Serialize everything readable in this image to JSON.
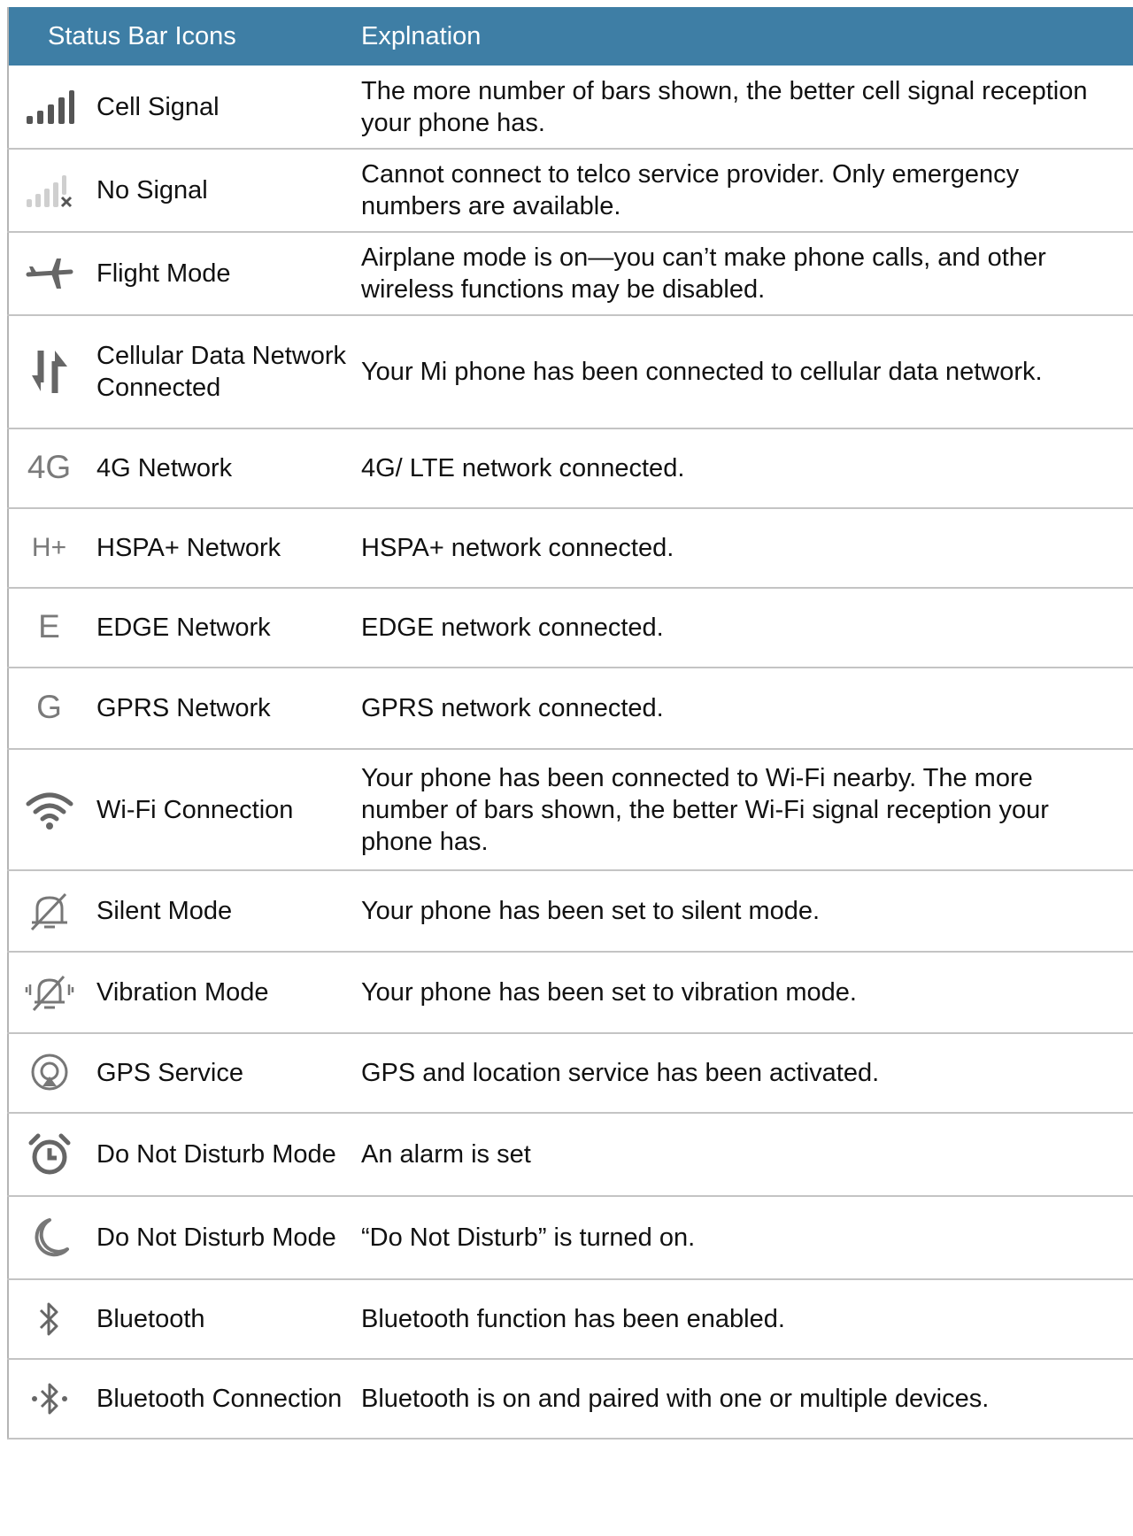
{
  "header": {
    "col_icons": "Status Bar Icons",
    "col_explanation": "Explnation"
  },
  "rows": [
    {
      "icon": "cell-signal-icon",
      "name": "Cell Signal",
      "explanation": "The more number of bars shown, the better cell signal reception your phone has."
    },
    {
      "icon": "no-signal-icon",
      "name": "No Signal",
      "explanation": "Cannot connect to telco service provider. Only emergency numbers are available."
    },
    {
      "icon": "airplane-icon",
      "name": "Flight Mode",
      "explanation": "Airplane mode is on—you can’t make phone calls, and other wireless functions may be disabled."
    },
    {
      "icon": "data-arrows-icon",
      "name": "Cellular Data Network Connected",
      "explanation": "Your Mi phone has been connected to cellular data network."
    },
    {
      "icon": "4g-icon",
      "icon_text": "4G",
      "name": "4G Network",
      "explanation": "4G/ LTE network connected."
    },
    {
      "icon": "hspa-plus-icon",
      "icon_text": "H+",
      "name": "HSPA+ Network",
      "explanation": "HSPA+ network connected."
    },
    {
      "icon": "edge-icon",
      "icon_text": "E",
      "name": "EDGE Network",
      "explanation": "EDGE network connected."
    },
    {
      "icon": "gprs-icon",
      "icon_text": "G",
      "name": "GPRS Network",
      "explanation": "GPRS network connected."
    },
    {
      "icon": "wifi-icon",
      "name": "Wi-Fi Connection",
      "explanation": "Your phone has been connected to Wi-Fi nearby.  The more number of bars shown, the better Wi-Fi signal reception your phone has."
    },
    {
      "icon": "bell-off-icon",
      "name": "Silent Mode",
      "explanation": "Your phone has been set to silent mode."
    },
    {
      "icon": "vibration-icon",
      "name": "Vibration Mode",
      "explanation": "Your phone has been set to vibration mode."
    },
    {
      "icon": "location-icon",
      "name": "GPS Service",
      "explanation": "GPS and location service has been activated."
    },
    {
      "icon": "alarm-clock-icon",
      "name": "Do Not Disturb Mode",
      "explanation": "An alarm is set"
    },
    {
      "icon": "moon-icon",
      "name": "Do Not Disturb Mode",
      "explanation": "“Do Not Disturb” is turned on."
    },
    {
      "icon": "bluetooth-icon",
      "name": "Bluetooth",
      "explanation": "Bluetooth function has been enabled."
    },
    {
      "icon": "bluetooth-connected-icon",
      "name": "Bluetooth Connection",
      "explanation": "Bluetooth is on and paired with one or multiple devices."
    }
  ]
}
